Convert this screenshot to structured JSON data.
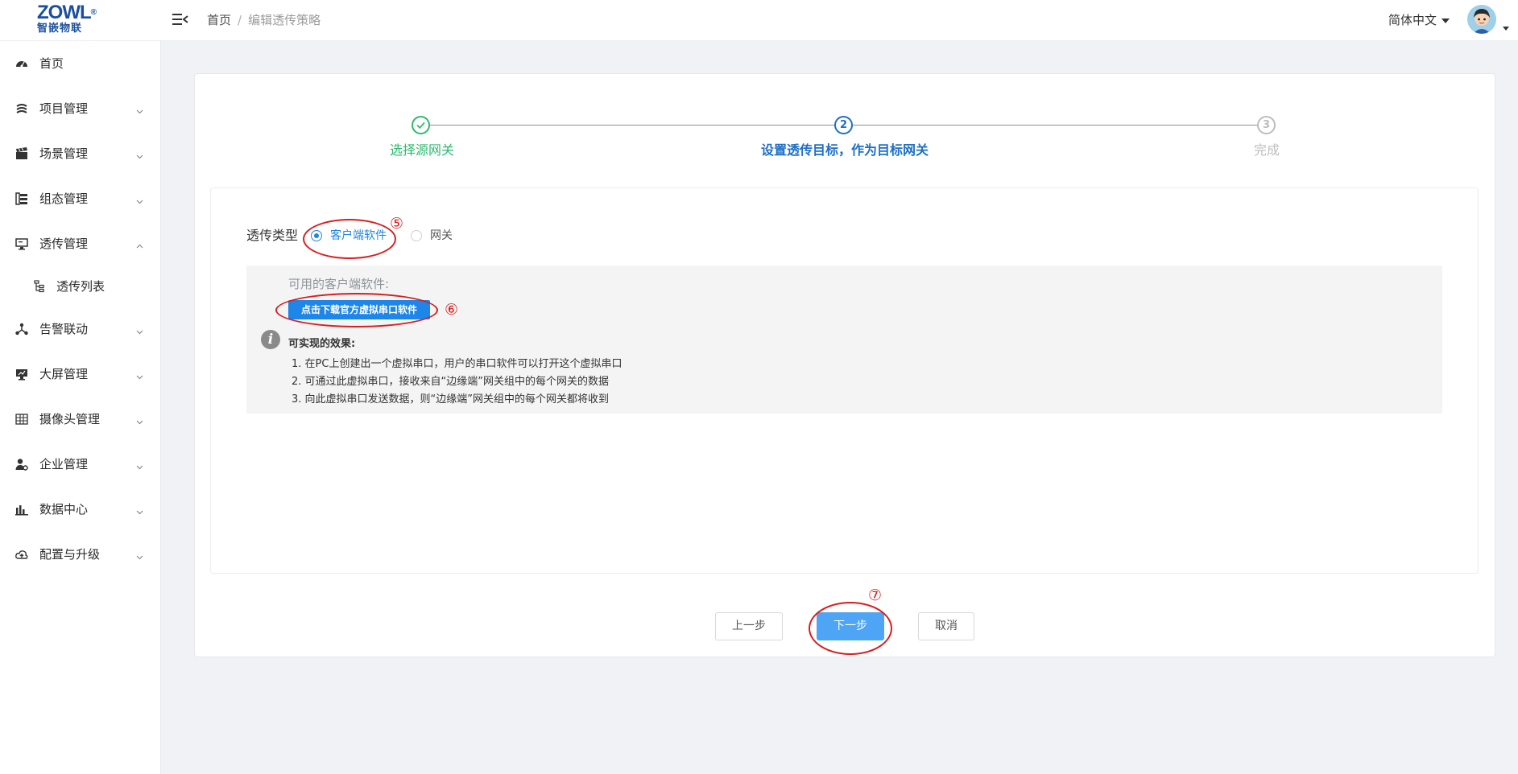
{
  "header": {
    "logo_top": "ZOWL",
    "logo_reg": "®",
    "logo_bottom": "智嵌物联",
    "breadcrumb_home": "首页",
    "breadcrumb_sep": "/",
    "breadcrumb_current": "编辑透传策略",
    "language": "简体中文"
  },
  "sidebar": {
    "items": [
      {
        "label": "首页",
        "icon": "dashboard-icon",
        "expanded": null
      },
      {
        "label": "项目管理",
        "icon": "layers-icon",
        "expanded": false
      },
      {
        "label": "场景管理",
        "icon": "clapperboard-icon",
        "expanded": false
      },
      {
        "label": "组态管理",
        "icon": "server-list-icon",
        "expanded": false
      },
      {
        "label": "透传管理",
        "icon": "monitor-icon",
        "expanded": true
      },
      {
        "label": "告警联动",
        "icon": "network-icon",
        "expanded": false
      },
      {
        "label": "大屏管理",
        "icon": "screen-icon",
        "expanded": false
      },
      {
        "label": "摄像头管理",
        "icon": "grid-icon",
        "expanded": false
      },
      {
        "label": "企业管理",
        "icon": "user-settings-icon",
        "expanded": false
      },
      {
        "label": "数据中心",
        "icon": "bar-chart-icon",
        "expanded": false
      },
      {
        "label": "配置与升级",
        "icon": "cloud-upload-icon",
        "expanded": false
      }
    ],
    "subitems": [
      {
        "label": "透传列表",
        "icon": "tree-icon"
      }
    ]
  },
  "steps": {
    "items": [
      {
        "number": "1",
        "label": "选择源网关",
        "status": "finished"
      },
      {
        "number": "2",
        "label": "设置透传目标，作为目标网关",
        "status": "active"
      },
      {
        "number": "3",
        "label": "完成",
        "status": "wait"
      }
    ],
    "colors": {
      "finished": "#2dbb6e",
      "active": "#1e6fc7",
      "wait": "#bdbdbd"
    }
  },
  "form": {
    "type_label": "透传类型",
    "radio_options": [
      {
        "label": "客户端软件",
        "selected": true
      },
      {
        "label": "网关",
        "selected": false
      }
    ],
    "available_label": "可用的客户端软件:",
    "download_button": "点击下载官方虚拟串口软件",
    "info_icon": "i",
    "effects_title": "可实现的效果:",
    "effects": [
      "1. 在PC上创建出一个虚拟串口，用户的串口软件可以打开这个虚拟串口",
      "2. 可通过此虚拟串口，接收来自“边缘端”网关组中的每个网关的数据",
      "3. 向此虚拟串口发送数据，则“边缘端”网关组中的每个网关都将收到"
    ]
  },
  "buttons": {
    "prev": "上一步",
    "next": "下一步",
    "cancel": "取消"
  },
  "annotations": {
    "five": "⑤",
    "six": "⑥",
    "seven": "⑦",
    "color": "#d81e1e"
  }
}
